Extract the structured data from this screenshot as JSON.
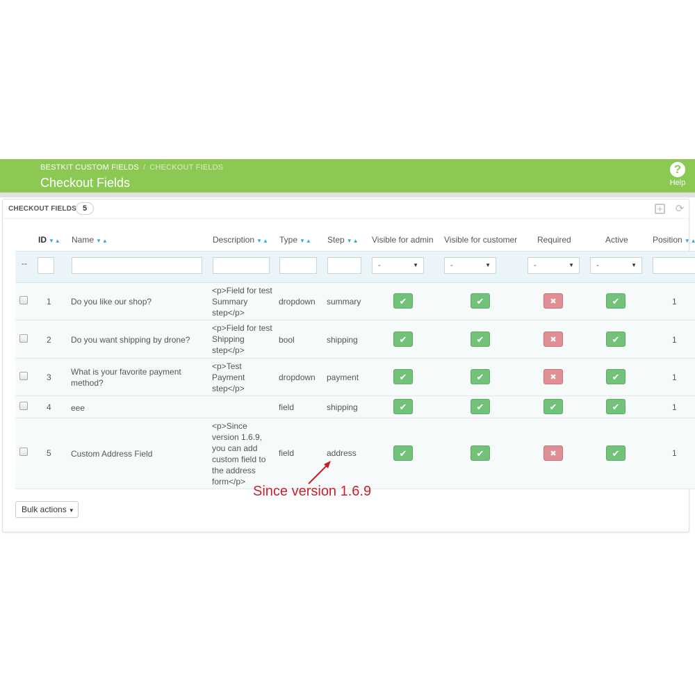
{
  "header": {
    "breadcrumb_parent": "BESTKIT CUSTOM FIELDS",
    "breadcrumb_current": "CHECKOUT FIELDS",
    "title": "Checkout Fields",
    "help_label": "Help",
    "help_glyph": "?"
  },
  "panel": {
    "title": "CHECKOUT FIELDS",
    "count": "5"
  },
  "columns": {
    "id": "ID",
    "name": "Name",
    "description": "Description",
    "type": "Type",
    "step": "Step",
    "visible_admin": "Visible for admin",
    "visible_customer": "Visible for customer",
    "required": "Required",
    "active": "Active",
    "position": "Position"
  },
  "filters": {
    "dash": "--",
    "select_value": "-"
  },
  "rows": [
    {
      "id": "1",
      "name": "Do you like our shop?",
      "description": "<p>Field for test Summary step</p>",
      "type": "dropdown",
      "step": "summary",
      "visible_admin": true,
      "visible_customer": true,
      "required": false,
      "active": true,
      "position": "1"
    },
    {
      "id": "2",
      "name": "Do you want shipping by drone?",
      "description": "<p>Field for test Shipping step</p>",
      "type": "bool",
      "step": "shipping",
      "visible_admin": true,
      "visible_customer": true,
      "required": false,
      "active": true,
      "position": "1"
    },
    {
      "id": "3",
      "name": "What is your favorite payment method?",
      "description": "<p>Test Payment step</p>",
      "type": "dropdown",
      "step": "payment",
      "visible_admin": true,
      "visible_customer": true,
      "required": false,
      "active": true,
      "position": "1"
    },
    {
      "id": "4",
      "name": "eee",
      "description": "",
      "type": "field",
      "step": "shipping",
      "visible_admin": true,
      "visible_customer": true,
      "required": true,
      "active": true,
      "position": "1"
    },
    {
      "id": "5",
      "name": "Custom Address Field",
      "description": "<p>Since version 1.6.9, you can add custom field to the address form</p>",
      "type": "field",
      "step": "address",
      "visible_admin": true,
      "visible_customer": true,
      "required": false,
      "active": true,
      "position": "1"
    }
  ],
  "bulk_actions_label": "Bulk actions",
  "annotation": "Since version 1.6.9",
  "colors": {
    "header": "#8bc954",
    "yes": "#72c279",
    "no": "#e08f95",
    "annotation": "#c8202b",
    "sort_arrow": "#2eacce"
  },
  "glyphs": {
    "check": "✔",
    "cross": "✖",
    "sort": "▼▲",
    "sort_active": "▼▲",
    "caret": "▼"
  }
}
